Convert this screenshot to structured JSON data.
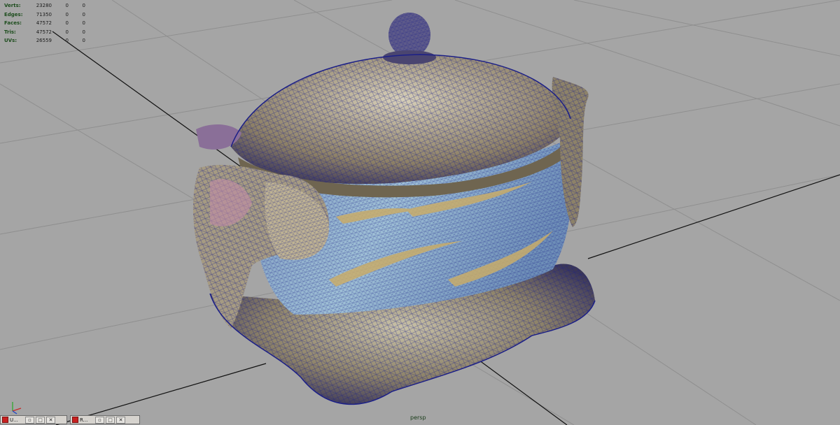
{
  "viewport": {
    "camera": "persp",
    "hud": [
      {
        "label": "Verts:",
        "value": "23280",
        "sel": "0",
        "comp": "0"
      },
      {
        "label": "Edges:",
        "value": "71350",
        "sel": "0",
        "comp": "0"
      },
      {
        "label": "Faces:",
        "value": "47572",
        "sel": "0",
        "comp": "0"
      },
      {
        "label": "Tris:",
        "value": "47572",
        "sel": "0",
        "comp": "0"
      },
      {
        "label": "UVs:",
        "value": "26559",
        "sel": "0",
        "comp": "0"
      }
    ]
  },
  "taskbar": {
    "items": [
      {
        "label": "U..."
      },
      {
        "label": "R..."
      }
    ]
  },
  "colors": {
    "background": "#a5a5a5",
    "grid": "#8f8f8f",
    "axis_line": "#111111",
    "wire": "#1b1f88"
  }
}
